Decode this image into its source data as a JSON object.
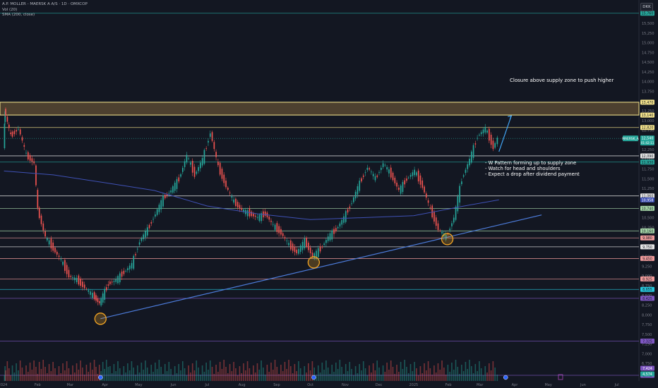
{
  "header": {
    "symbol_line": "A.P. MOLLER - MAERSK A A/S · 1D · OMXCOP",
    "vol_label": "Vol (20)",
    "sma_label": "SMA (200, close)",
    "currency": "DKK"
  },
  "annotations": {
    "supply_note": "Closure above supply zone to push higher",
    "note_lines": [
      "- W Pattern forming up to supply zone",
      "- Watch for head and shoulders",
      "- Expect a drop after dividend payment"
    ]
  },
  "chart_data": {
    "type": "candlestick",
    "title": "A.P. MOLLER - MAERSK A A/S · 1D · OMXCOP",
    "ylabel": "DKK",
    "ylim": [
      6300,
      15900
    ],
    "y_ticks": [
      "15,750",
      "15,500",
      "15,250",
      "15,000",
      "14,750",
      "14,500",
      "14,250",
      "14,000",
      "13,750",
      "13,500",
      "13,250",
      "13,000",
      "12,750",
      "12,500",
      "12,250",
      "12,000",
      "11,750",
      "11,500",
      "11,250",
      "11,000",
      "10,750",
      "10,500",
      "10,250",
      "10,000",
      "9,750",
      "9,500",
      "9,250",
      "9,000",
      "8,750",
      "8,500",
      "8,250",
      "8,000",
      "7,750",
      "7,500",
      "7,250",
      "7,000",
      "6,750",
      "6,500"
    ],
    "x_ticks": [
      "2024",
      "Feb",
      "Mar",
      "Apr",
      "May",
      "Jun",
      "Jul",
      "Aug",
      "Sep",
      "Oct",
      "Nov",
      "Dec",
      "2025",
      "Feb",
      "Mar",
      "Apr",
      "May",
      "Jun",
      "Jul"
    ],
    "supply_zone": [
      13140,
      13470
    ],
    "price_levels": [
      {
        "label": "15,760",
        "color": "#26a69a"
      },
      {
        "label": "13,470",
        "color": "#f6e58d"
      },
      {
        "label": "13,140",
        "color": "#f6e58d"
      },
      {
        "label": "12,820",
        "color": "#f6e58d"
      },
      {
        "label": "12,090",
        "color": "#e6e6e6"
      },
      {
        "label": "11,930",
        "color": "#26a69a"
      },
      {
        "label": "11,060",
        "color": "#e6e6e6"
      },
      {
        "label": "10,740",
        "color": "#a5d6a7"
      },
      {
        "label": "10,160",
        "color": "#a5d6a7"
      },
      {
        "label": "9,980",
        "color": "#ef9a9a"
      },
      {
        "label": "9,750",
        "color": "#e6e6e6"
      },
      {
        "label": "9,450",
        "color": "#ef9a9a"
      },
      {
        "label": "8,925",
        "color": "#ef9a9a"
      },
      {
        "label": "8,655",
        "color": "#26c6da"
      },
      {
        "label": "8,425",
        "color": "#7e57c2"
      },
      {
        "label": "7,325",
        "color": "#7e57c2"
      },
      {
        "label": "6,445",
        "color": "#7e57c2"
      }
    ],
    "current_price": {
      "label": "12,540",
      "symbol": "MAERSK_A",
      "countdown": "01:42:11"
    },
    "sma_label": "10,958",
    "volume_labels": [
      "7,424",
      "4,574"
    ],
    "series": [
      {
        "name": "MAERSK_A",
        "points": [
          [
            "2024-01-02",
            12400
          ],
          [
            "2024-01-03",
            13300
          ],
          [
            "2024-01-09",
            12600
          ],
          [
            "2024-01-16",
            12800
          ],
          [
            "2024-01-23",
            12100
          ],
          [
            "2024-01-30",
            11900
          ],
          [
            "2024-02-02",
            10700
          ],
          [
            "2024-02-09",
            10000
          ],
          [
            "2024-02-16",
            9700
          ],
          [
            "2024-02-23",
            9400
          ],
          [
            "2024-03-01",
            9000
          ],
          [
            "2024-03-08",
            8900
          ],
          [
            "2024-03-15",
            8700
          ],
          [
            "2024-03-22",
            8500
          ],
          [
            "2024-03-28",
            8300
          ],
          [
            "2024-04-05",
            8800
          ],
          [
            "2024-04-12",
            8900
          ],
          [
            "2024-04-19",
            9100
          ],
          [
            "2024-04-26",
            9300
          ],
          [
            "2024-05-03",
            9900
          ],
          [
            "2024-05-10",
            10200
          ],
          [
            "2024-05-17",
            10600
          ],
          [
            "2024-05-24",
            11000
          ],
          [
            "2024-05-31",
            11200
          ],
          [
            "2024-06-07",
            11500
          ],
          [
            "2024-06-14",
            12100
          ],
          [
            "2024-06-21",
            11600
          ],
          [
            "2024-06-28",
            12000
          ],
          [
            "2024-07-05",
            12700
          ],
          [
            "2024-07-12",
            11800
          ],
          [
            "2024-07-19",
            11300
          ],
          [
            "2024-07-26",
            10900
          ],
          [
            "2024-08-02",
            10700
          ],
          [
            "2024-08-09",
            10600
          ],
          [
            "2024-08-16",
            10500
          ],
          [
            "2024-08-23",
            10600
          ],
          [
            "2024-08-30",
            10300
          ],
          [
            "2024-09-06",
            10100
          ],
          [
            "2024-09-13",
            9800
          ],
          [
            "2024-09-20",
            9600
          ],
          [
            "2024-09-27",
            9900
          ],
          [
            "2024-10-04",
            9500
          ],
          [
            "2024-10-11",
            9700
          ],
          [
            "2024-10-18",
            10000
          ],
          [
            "2024-10-25",
            10200
          ],
          [
            "2024-11-01",
            10500
          ],
          [
            "2024-11-08",
            10900
          ],
          [
            "2024-11-15",
            11400
          ],
          [
            "2024-11-22",
            11800
          ],
          [
            "2024-11-29",
            11500
          ],
          [
            "2024-12-06",
            11900
          ],
          [
            "2024-12-13",
            11600
          ],
          [
            "2024-12-20",
            11200
          ],
          [
            "2024-12-27",
            11500
          ],
          [
            "2025-01-03",
            11700
          ],
          [
            "2025-01-10",
            11300
          ],
          [
            "2025-01-17",
            10700
          ],
          [
            "2025-01-24",
            10200
          ],
          [
            "2025-01-31",
            10000
          ],
          [
            "2025-02-07",
            10500
          ],
          [
            "2025-02-14",
            11500
          ],
          [
            "2025-02-21",
            12000
          ],
          [
            "2025-02-28",
            12600
          ],
          [
            "2025-03-07",
            12800
          ],
          [
            "2025-03-14",
            12300
          ],
          [
            "2025-03-18",
            12540
          ]
        ]
      },
      {
        "name": "SMA (200, close)",
        "points": [
          [
            "2024-01-02",
            11700
          ],
          [
            "2024-02-15",
            11600
          ],
          [
            "2024-04-01",
            11400
          ],
          [
            "2024-05-15",
            11200
          ],
          [
            "2024-07-01",
            10800
          ],
          [
            "2024-08-15",
            10600
          ],
          [
            "2024-10-01",
            10450
          ],
          [
            "2024-11-15",
            10500
          ],
          [
            "2025-01-01",
            10550
          ],
          [
            "2025-02-15",
            10800
          ],
          [
            "2025-03-18",
            10958
          ]
        ]
      }
    ],
    "trendline": [
      [
        "2024-03-28",
        7900
      ],
      [
        "2025-04-25",
        10570
      ]
    ],
    "markers": [
      [
        "2024-03-28",
        7900
      ],
      [
        "2024-10-04",
        9350
      ],
      [
        "2025-01-31",
        9950
      ]
    ],
    "projection": [
      [
        "2025-03-18",
        12200
      ],
      [
        "2025-03-24",
        13120
      ]
    ]
  }
}
